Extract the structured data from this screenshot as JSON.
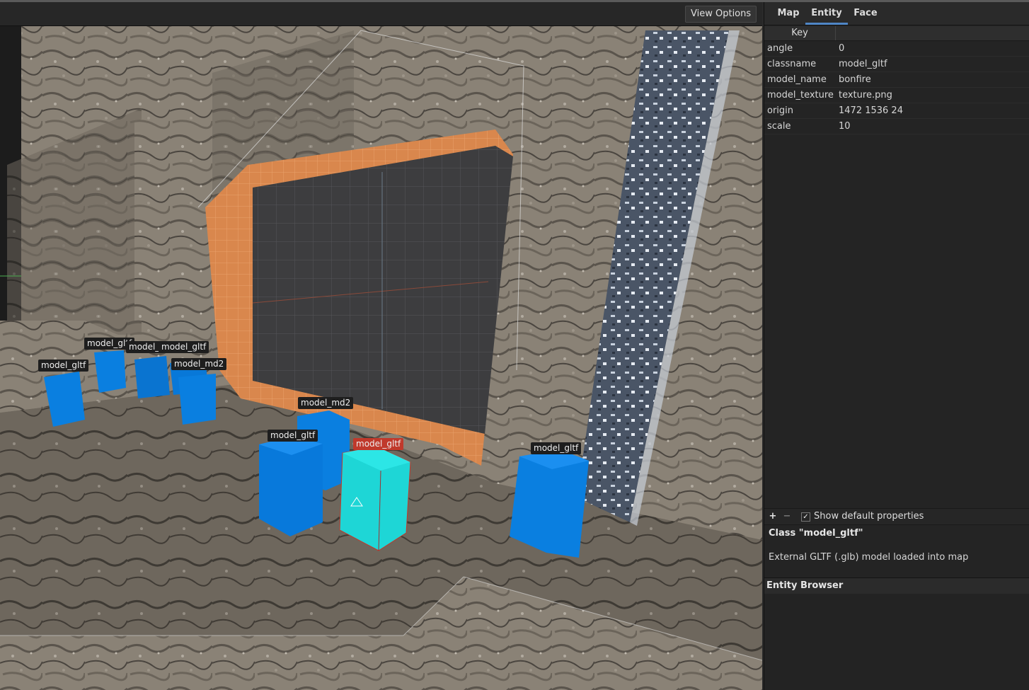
{
  "toolbar": {
    "view_options_label": "View Options"
  },
  "viewport": {
    "entity_labels": [
      {
        "text": "model_gltf"
      },
      {
        "text": "model_gltf"
      },
      {
        "text": "model_"
      },
      {
        "text": "model_gltf"
      },
      {
        "text": "model_md2"
      },
      {
        "text": "model_md2"
      },
      {
        "text": "model_gltf"
      },
      {
        "text": "model_gltf",
        "selected": true
      },
      {
        "text": "model_gltf"
      }
    ],
    "colors": {
      "entity": "#0a7fe0",
      "selected_entity": "#1ed6d6",
      "selected_label": "#c0392b",
      "trim": "#e08a4a",
      "grid_wall": "#3d3d3d"
    }
  },
  "tabs": [
    {
      "label": "Map",
      "active": false
    },
    {
      "label": "Entity",
      "active": true
    },
    {
      "label": "Face",
      "active": false
    }
  ],
  "properties": {
    "key_header": "Key",
    "rows": [
      {
        "key": "angle",
        "value": "0"
      },
      {
        "key": "classname",
        "value": "model_gltf"
      },
      {
        "key": "model_name",
        "value": "bonfire"
      },
      {
        "key": "model_texture",
        "value": "texture.png"
      },
      {
        "key": "origin",
        "value": "1472 1536 24"
      },
      {
        "key": "scale",
        "value": "10"
      }
    ],
    "add_label": "+",
    "remove_label": "−",
    "show_default_check": "✓",
    "show_default_label": "Show default properties"
  },
  "class_info": {
    "title": "Class \"model_gltf\"",
    "description": "External GLTF (.glb) model loaded into map"
  },
  "entity_browser": {
    "title": "Entity Browser"
  }
}
